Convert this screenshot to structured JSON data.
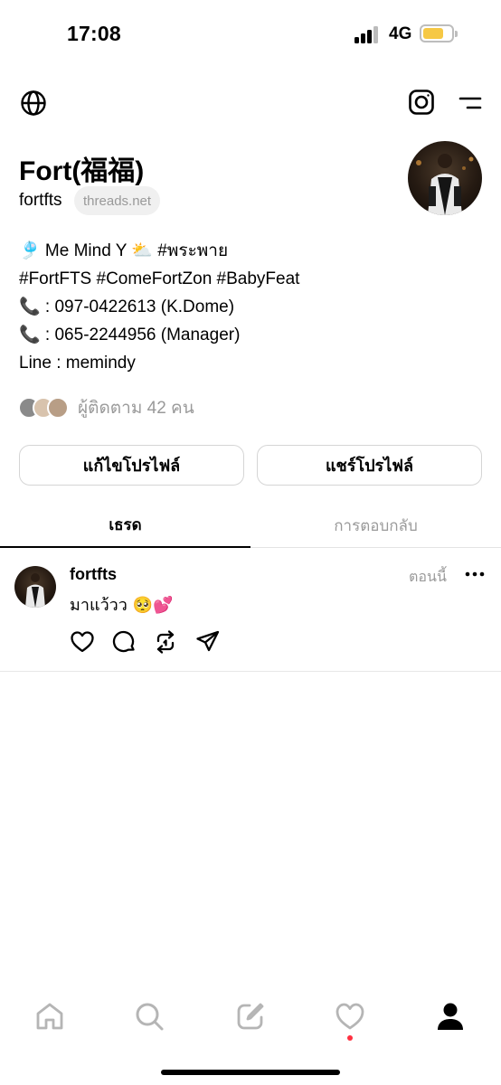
{
  "status_bar": {
    "time": "17:08",
    "network": "4G"
  },
  "profile": {
    "name": "Fort(福福)",
    "handle": "fortfts",
    "domain_pill": "threads.net",
    "bio_lines": [
      "🎐 Me Mind Y ⛅️ #พระพาย",
      "#FortFTS #ComeFortZon #BabyFeat",
      "📞 : 097-0422613 (K.Dome)",
      "📞 : 065-2244956 (Manager)",
      "Line : memindy"
    ],
    "followers_text": "ผู้ติดตาม 42 คน"
  },
  "buttons": {
    "edit": "แก้ไขโปรไฟล์",
    "share": "แชร์โปรไฟล์"
  },
  "tabs": {
    "threads": "เธรด",
    "replies": "การตอบกลับ"
  },
  "post": {
    "user": "fortfts",
    "time": "ตอนนี้",
    "text": "มาแว้วว 🥺💕"
  },
  "icons": {
    "top_left": "globe-icon",
    "top_right": [
      "instagram-icon",
      "menu-icon"
    ],
    "post_actions": [
      "heart-icon",
      "comment-icon",
      "repost-icon",
      "share-icon"
    ],
    "nav": [
      "home-icon",
      "search-icon",
      "compose-icon",
      "heart-icon",
      "profile-icon"
    ]
  },
  "colors": {
    "battery": "#f6c844",
    "notification_dot": "#ff3040",
    "muted_text": "#9a9a9a"
  }
}
